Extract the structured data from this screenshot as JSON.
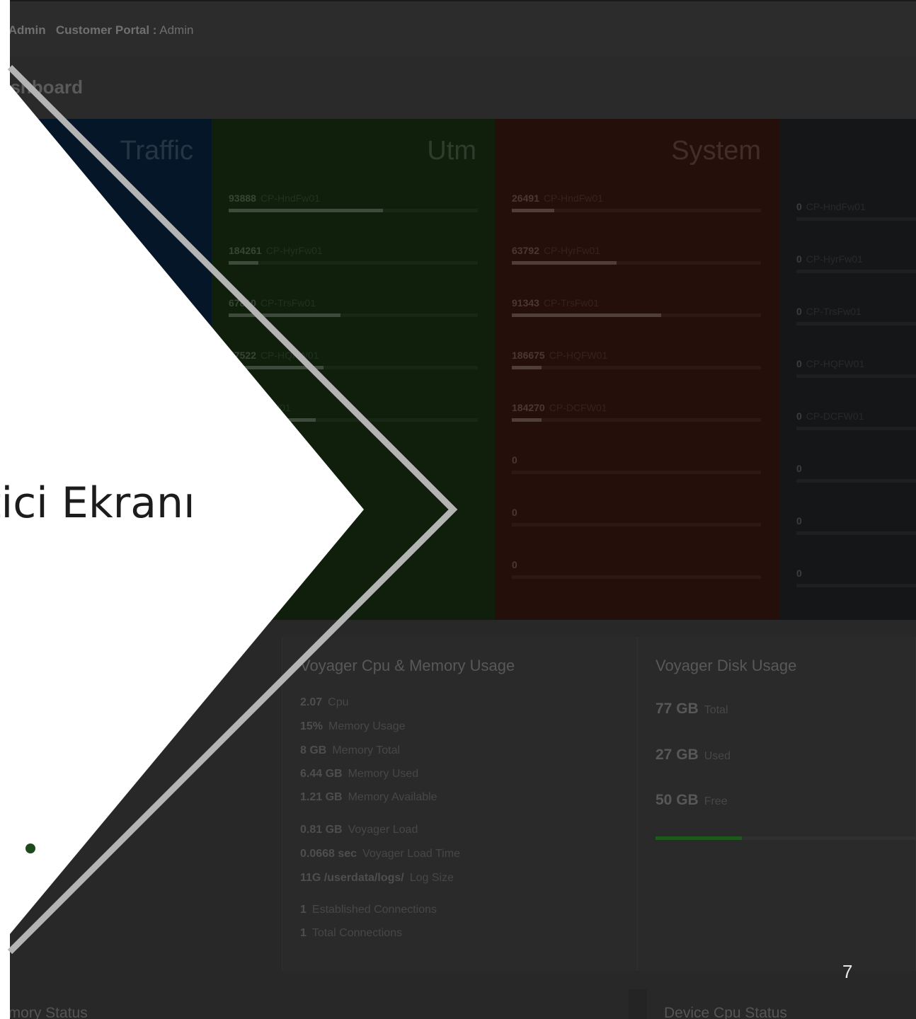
{
  "header": {
    "role_tail": ": Admin",
    "portal_label": "Customer Portal :",
    "portal_value": " Admin"
  },
  "page_title": "ashboard",
  "panels": {
    "traffic": {
      "title": "Traffic"
    },
    "utm": {
      "title": "Utm",
      "rows": [
        {
          "value": "93888",
          "device": "CP-HndFw01",
          "level": 0.62
        },
        {
          "value": "184261",
          "device": "CP-HyrFw01",
          "level": 0.12
        },
        {
          "value": "67810",
          "device": "CP-TrsFw01",
          "level": 0.45
        },
        {
          "value": "57522",
          "device": "CP-HQFW01",
          "level": 0.38
        },
        {
          "value": "",
          "device": "CP-DCFW01",
          "level": 0.35
        }
      ]
    },
    "system": {
      "title": "System",
      "rows": [
        {
          "value": "26491",
          "device": "CP-HndFw01",
          "level": 0.17
        },
        {
          "value": "63792",
          "device": "CP-HyrFw01",
          "level": 0.42
        },
        {
          "value": "91343",
          "device": "CP-TrsFw01",
          "level": 0.6
        },
        {
          "value": "186675",
          "device": "CP-HQFW01",
          "level": 0.12
        },
        {
          "value": "184270",
          "device": "CP-DCFW01",
          "level": 0.12
        },
        {
          "value": "0",
          "device": "",
          "level": 0
        },
        {
          "value": "0",
          "device": "",
          "level": 0
        },
        {
          "value": "0",
          "device": "",
          "level": 0
        }
      ]
    },
    "fourth": {
      "rows": [
        {
          "value": "0",
          "device": "CP-HndFw01"
        },
        {
          "value": "0",
          "device": "CP-HyrFw01"
        },
        {
          "value": "0",
          "device": "CP-TrsFw01"
        },
        {
          "value": "0",
          "device": "CP-HQFW01"
        },
        {
          "value": "0",
          "device": "CP-DCFW01"
        },
        {
          "value": "0",
          "device": ""
        },
        {
          "value": "0",
          "device": ""
        },
        {
          "value": "0",
          "device": ""
        }
      ]
    }
  },
  "cpu_card": {
    "title": "Voyager Cpu & Memory Usage",
    "stats": [
      {
        "value": "2.07",
        "label": "Cpu"
      },
      {
        "value": "15%",
        "label": "Memory Usage"
      },
      {
        "value": "8 GB",
        "label": "Memory Total"
      },
      {
        "value": "6.44 GB",
        "label": "Memory Used"
      },
      {
        "value": "1.21 GB",
        "label": "Memory Available"
      },
      {
        "value": "0.81 GB",
        "label": "Voyager Load"
      },
      {
        "value": "0.0668 sec",
        "label": "Voyager Load Time"
      },
      {
        "value": "11G /userdata/logs/",
        "label": "Log Size"
      },
      {
        "value": "1",
        "label": "Established Connections"
      },
      {
        "value": "1",
        "label": "Total Connections"
      }
    ]
  },
  "disk_card": {
    "title": "Voyager Disk Usage",
    "total": {
      "value": "77 GB",
      "label": "Total"
    },
    "used": {
      "value": "27 GB",
      "label": "Used"
    },
    "free": {
      "value": "50 GB",
      "label": "Free"
    },
    "used_fraction": 0.33
  },
  "bottom": {
    "left_title": "emory Status",
    "right_title": "Device Cpu Status"
  },
  "slide": {
    "title": "tici Ekranı",
    "page_number": "7"
  }
}
